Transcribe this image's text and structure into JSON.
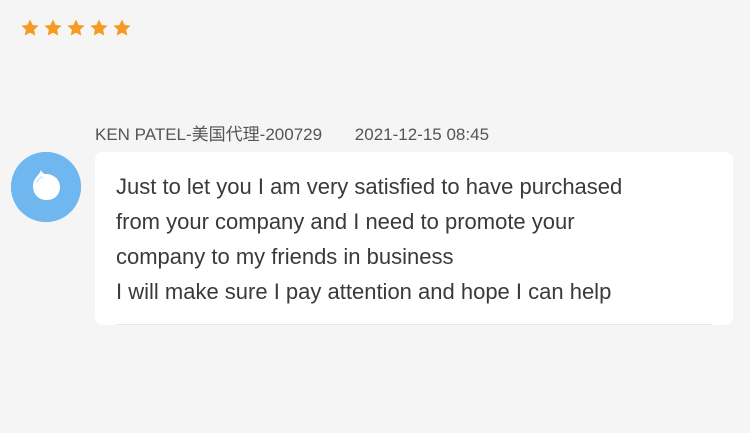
{
  "review": {
    "rating": 5,
    "star_color": "#f59a23"
  },
  "message": {
    "sender": "KEN PATEL-美国代理-200729",
    "timestamp": "2021-12-15 08:45",
    "avatar_icon": "speech-bubble-icon",
    "avatar_color": "#6fb7ee",
    "lines": [
      "Just to let you I am very satisfied to have purchased",
      "from your company and I need to promote your",
      "company to my friends in business",
      "I will make sure I pay attention and hope I can help"
    ]
  }
}
